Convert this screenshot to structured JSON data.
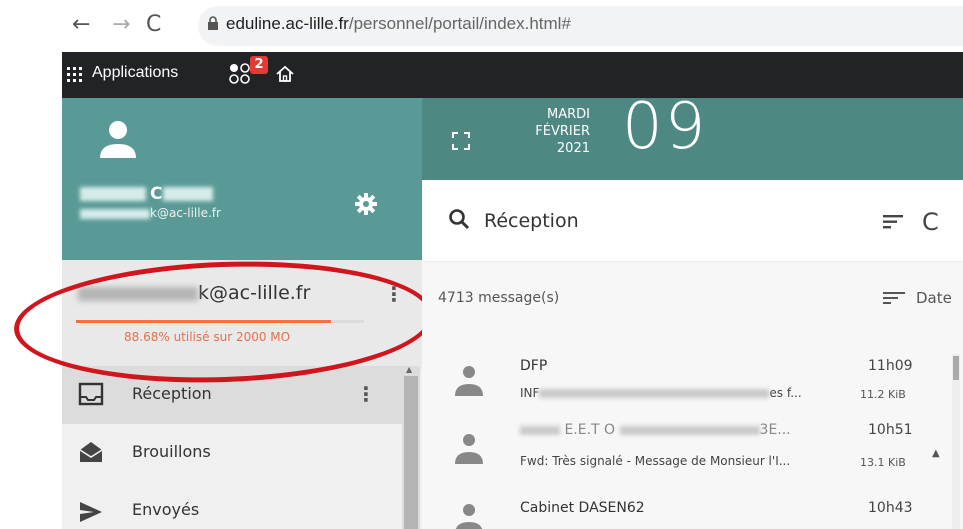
{
  "browser": {
    "url_host": "eduline.ac-lille.fr",
    "url_path": "/personnel/portail/index.html#"
  },
  "appbar": {
    "apps_label": "Applications",
    "notification_count": "2"
  },
  "profile": {
    "name_suffix": "C",
    "email_suffix": "k@ac-lille.fr"
  },
  "account": {
    "email_suffix": "k@ac-lille.fr",
    "quota_text": "88.68% utilisé sur 2000 MO",
    "quota_percent": 88.68,
    "menu": "⋮"
  },
  "folders": [
    {
      "label": "Réception",
      "menu": "⋮",
      "icon": "inbox-icon"
    },
    {
      "label": "Brouillons",
      "menu": "",
      "icon": "drafts-icon"
    },
    {
      "label": "Envoyés",
      "menu": "",
      "icon": "sent-icon"
    }
  ],
  "date": {
    "weekday": "MARDI",
    "month": "FÉVRIER",
    "year": "2021",
    "day": "09"
  },
  "toolbar": {
    "folder_title": "Réception"
  },
  "list": {
    "count": "4713 message(s)",
    "sort_label": "Date",
    "messages": [
      {
        "from": "DFP",
        "subject_prefix": "INF",
        "subject_suffix": "es f...",
        "time": "11h09",
        "size": "11.2 KiB"
      },
      {
        "from_middle": "E.E.T O",
        "from_suffix": "3E...",
        "subject": "Fwd: Très signalé - Message de Monsieur l'I...",
        "time": "10h51",
        "size": "13.1 KiB"
      },
      {
        "from": "Cabinet DASEN62",
        "subject": "",
        "time": "10h43",
        "size": ""
      }
    ]
  },
  "colors": {
    "profile_bg": "#5a9a96",
    "header_bg": "#4e8883",
    "quota": "#f4733c",
    "highlight": "#d0151d"
  }
}
